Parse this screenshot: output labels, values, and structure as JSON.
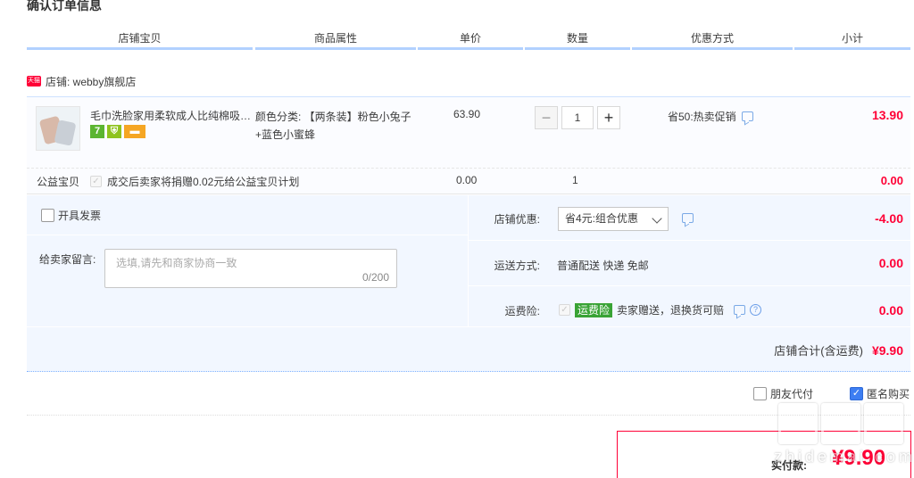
{
  "section_title": "确认订单信息",
  "columns": {
    "shop_item": "店铺宝贝",
    "attributes": "商品属性",
    "unit_price": "单价",
    "quantity": "数量",
    "discount": "优惠方式",
    "subtotal": "小计"
  },
  "shop": {
    "badge": "天猫",
    "label": "店铺: webby旗舰店"
  },
  "item": {
    "title": "毛巾洗脸家用柔软成人比纯棉吸…",
    "service_icons": [
      "7",
      "s",
      "card"
    ],
    "attribute_text": "颜色分类: 【两条装】粉色小兔子+蓝色小蜜蜂",
    "price": "63.90",
    "quantity": "1",
    "promo_text": "省50:热卖促销",
    "subtotal": "13.90"
  },
  "charity": {
    "label": "公益宝贝",
    "text": "成交后卖家将捐赠0.02元给公益宝贝计划",
    "price": "0.00",
    "quantity": "1",
    "subtotal": "0.00"
  },
  "invoice_label": "开具发票",
  "message": {
    "label": "给卖家留言:",
    "placeholder": "选填,请先和商家协商一致",
    "count": "0/200"
  },
  "shop_promo": {
    "label": "店铺优惠:",
    "selected": "省4元:组合优惠",
    "amount": "-4.00"
  },
  "shipping": {
    "label": "运送方式:",
    "text": "普通配送 快递 免邮",
    "amount": "0.00"
  },
  "insurance": {
    "label": "运费险:",
    "tag": "运费险",
    "text": "卖家赠送，退换货可赔",
    "amount": "0.00"
  },
  "shop_total": {
    "label": "店铺合计(含运费)",
    "value": "¥9.90"
  },
  "agent_pay_label": "朋友代付",
  "anonymous_label": "匿名购买",
  "pay": {
    "label": "实付款:",
    "amount": "¥9.90"
  },
  "watermark_text": "zhidemai.com",
  "colors": {
    "accent_red": "#ff0036",
    "header_line": "#b2d1ff",
    "panel_bg": "#f2f7ff",
    "checkbox_blue": "#3d7ef2",
    "insurance_green": "#39a335"
  }
}
